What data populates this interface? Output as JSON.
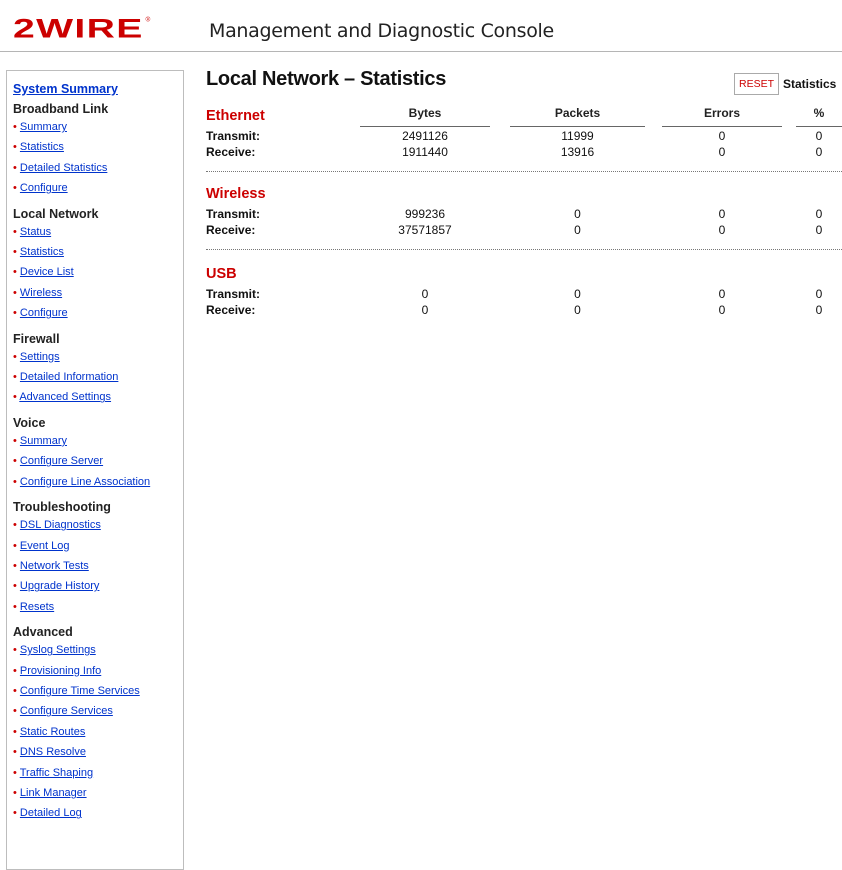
{
  "header": {
    "logo_text": "2WIRE",
    "title": "Management and Diagnostic Console"
  },
  "sidebar": {
    "top_link": "System Summary",
    "sections": [
      {
        "heading": "Broadband Link",
        "items": [
          "Summary",
          "Statistics",
          "Detailed Statistics",
          "Configure"
        ]
      },
      {
        "heading": "Local Network",
        "items": [
          "Status",
          "Statistics",
          "Device List",
          "Wireless",
          "Configure"
        ]
      },
      {
        "heading": "Firewall",
        "items": [
          "Settings",
          "Detailed Information",
          "Advanced Settings"
        ]
      },
      {
        "heading": "Voice",
        "items": [
          "Summary",
          "Configure Server",
          "Configure Line Association"
        ]
      },
      {
        "heading": "Troubleshooting",
        "items": [
          "DSL Diagnostics",
          "Event Log",
          "Network Tests",
          "Upgrade History",
          "Resets"
        ]
      },
      {
        "heading": "Advanced",
        "items": [
          "Syslog Settings",
          "Provisioning Info",
          "Configure Time Services",
          "Configure Services",
          "Static Routes",
          "DNS Resolve",
          "Traffic Shaping",
          "Link Manager",
          "Detailed Log"
        ]
      }
    ]
  },
  "main": {
    "title": "Local Network – Statistics",
    "reset_label": "RESET",
    "statistics_label": "Statistics",
    "columns": [
      "Bytes",
      "Packets",
      "Errors",
      "%"
    ],
    "row_labels": {
      "transmit": "Transmit:",
      "receive": "Receive:"
    },
    "sections": [
      {
        "name": "Ethernet",
        "transmit": [
          "2491126",
          "11999",
          "0",
          "0"
        ],
        "receive": [
          "1911440",
          "13916",
          "0",
          "0"
        ]
      },
      {
        "name": "Wireless",
        "transmit": [
          "999236",
          "0",
          "0",
          "0"
        ],
        "receive": [
          "37571857",
          "0",
          "0",
          "0"
        ]
      },
      {
        "name": "USB",
        "transmit": [
          "0",
          "0",
          "0",
          "0"
        ],
        "receive": [
          "0",
          "0",
          "0",
          "0"
        ]
      }
    ]
  },
  "colors": {
    "brand_red": "#cc0000",
    "link_blue": "#0033cc"
  }
}
